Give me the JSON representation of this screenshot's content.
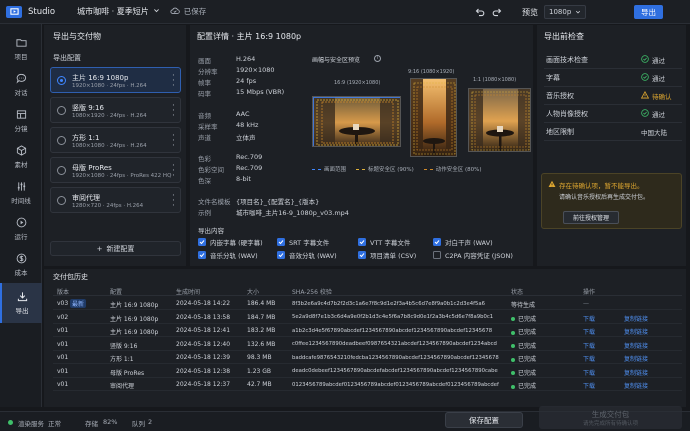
{
  "app": {
    "name": "Studio",
    "project": "城市咖啡 · 夏季短片",
    "saved": "已保存"
  },
  "toolbar": {
    "preview_label": "预览",
    "resolution": "1080p",
    "export_label": "导出"
  },
  "sidebar": [
    {
      "label": "项目",
      "icon": "folder-icon"
    },
    {
      "label": "对话",
      "icon": "chat-icon"
    },
    {
      "label": "分镜",
      "icon": "storyboard-icon"
    },
    {
      "label": "素材",
      "icon": "cube-icon"
    },
    {
      "label": "时间线",
      "icon": "sliders-icon"
    },
    {
      "label": "运行",
      "icon": "play-icon"
    },
    {
      "label": "成本",
      "icon": "dollar-icon"
    },
    {
      "label": "导出",
      "icon": "download-icon",
      "active": true
    }
  ],
  "left": {
    "title": "导出与交付物",
    "presets_label": "导出配置",
    "presets": [
      {
        "name": "主片 16:9 1080p",
        "desc": "1920×1080 · 24fps · H.264",
        "active": true
      },
      {
        "name": "竖版 9:16",
        "desc": "1080×1920 · 24fps · H.264"
      },
      {
        "name": "方形 1:1",
        "desc": "1080×1080 · 24fps · H.264"
      },
      {
        "name": "母版 ProRes",
        "desc": "1920×1080 · 24fps · ProRes 422 HQ"
      },
      {
        "name": "审阅代理",
        "desc": "1280×720 · 24fps · H.264"
      }
    ],
    "new_preset": "新建配置"
  },
  "details": {
    "title": "配置详情 · 主片 16:9 1080p",
    "video": [
      {
        "k": "画面",
        "v": "H.264"
      },
      {
        "k": "分辨率",
        "v": "1920×1080"
      },
      {
        "k": "帧率",
        "v": "24 fps"
      },
      {
        "k": "码率",
        "v": "15 Mbps (VBR)"
      }
    ],
    "audio": [
      {
        "k": "音频",
        "v": "AAC"
      },
      {
        "k": "采样率",
        "v": "48 kHz"
      },
      {
        "k": "声道",
        "v": "立体声"
      }
    ],
    "color": [
      {
        "k": "色彩",
        "v": "Rec.709"
      },
      {
        "k": "色彩空间",
        "v": "Rec.709"
      },
      {
        "k": "色深",
        "v": "8-bit"
      }
    ],
    "naming": [
      {
        "k": "文件名模板",
        "v": "{项目名}_{配置名}_{版本}"
      },
      {
        "k": "示例",
        "v": "城市咖啡_主片16-9_1080p_v03.mp4"
      }
    ],
    "safe_title": "画幅与安全区预览",
    "frames": [
      {
        "label": "16:9 (1920×1080)"
      },
      {
        "label": "9:16 (1080×1920)"
      },
      {
        "label": "1:1 (1080×1080)"
      }
    ],
    "legend": [
      {
        "label": "画面范围",
        "color": "#3f86ff"
      },
      {
        "label": "标题安全区 (90%)",
        "color": "#e0b23a"
      },
      {
        "label": "动作安全区 (80%)",
        "color": "#d08a2a"
      }
    ],
    "outputs_title": "导出内容",
    "outputs": [
      {
        "label": "内嵌字幕 (硬字幕)",
        "checked": true
      },
      {
        "label": "SRT 字幕文件",
        "checked": true
      },
      {
        "label": "VTT 字幕文件",
        "checked": true
      },
      {
        "label": "对白干声 (WAV)",
        "checked": true
      },
      {
        "label": "音乐分轨 (WAV)",
        "checked": true
      },
      {
        "label": "音效分轨 (WAV)",
        "checked": true
      },
      {
        "label": "项目清单 (CSV)",
        "checked": true
      },
      {
        "label": "C2PA 内容凭证 (JSON)",
        "checked": false
      }
    ]
  },
  "checks": {
    "title": "导出前检查",
    "items": [
      {
        "label": "画面技术检查",
        "status": "通过",
        "state": "pass"
      },
      {
        "label": "字幕",
        "status": "通过",
        "state": "pass"
      },
      {
        "label": "音乐授权",
        "status": "待确认",
        "state": "warn"
      },
      {
        "label": "人物肖像授权",
        "status": "通过",
        "state": "pass"
      },
      {
        "label": "地区限制",
        "status": "中国大陆",
        "state": "info"
      }
    ],
    "warn_title": "存在待确认项，暂不能导出。",
    "warn_body": "请确认音乐授权后再生成交付包。",
    "warn_button": "前往授权管理"
  },
  "history": {
    "title": "交付包历史",
    "columns": [
      "版本",
      "配置",
      "生成时间",
      "大小",
      "SHA-256 校验",
      "状态",
      "操作"
    ],
    "rows": [
      {
        "ver": "v03",
        "tag": "最新",
        "cfg": "主片 16:9 1080p",
        "time": "2024-05-18 14:22",
        "size": "186.4 MB",
        "sha": "8f3b2e6a9c4d7b2f2d3c1a6e7f8c9d1e2f3a4b5c6d7e8f9a0b1c2d3e4f5a6",
        "status": "等待生成",
        "state": "pending",
        "action1": "",
        "action2": ""
      },
      {
        "ver": "v02",
        "tag": "",
        "cfg": "主片 16:9 1080p",
        "time": "2024-05-18 13:58",
        "size": "184.7 MB",
        "sha": "5e2a9d8f7e1b3c6d4a9e0f2b1d3c4e5f6a7b8c9d0e1f2a3b4c5d6e7f8a9b0c1",
        "status": "已完成",
        "state": "done",
        "action1": "下载",
        "action2": "复制链接"
      },
      {
        "ver": "v01",
        "tag": "",
        "cfg": "主片 16:9 1080p",
        "time": "2024-05-18 12:41",
        "size": "183.2 MB",
        "sha": "a1b2c3d4e5f67890abcdef1234567890abcdef1234567890abcdef12345678",
        "status": "已完成",
        "state": "done",
        "action1": "下载",
        "action2": "复制链接"
      },
      {
        "ver": "v01",
        "tag": "",
        "cfg": "竖版 9:16",
        "time": "2024-05-18 12:40",
        "size": "132.6 MB",
        "sha": "c0ffee1234567890deadbeef0987654321abcdef1234567890abcdef1234abcd",
        "status": "已完成",
        "state": "done",
        "action1": "下载",
        "action2": "复制链接"
      },
      {
        "ver": "v01",
        "tag": "",
        "cfg": "方形 1:1",
        "time": "2024-05-18 12:39",
        "size": "98.3 MB",
        "sha": "baddcafe9876543210fedcba1234567890abcdef1234567890abcdef12345678",
        "status": "已完成",
        "state": "done",
        "action1": "下载",
        "action2": "复制链接"
      },
      {
        "ver": "v01",
        "tag": "",
        "cfg": "母版 ProRes",
        "time": "2024-05-18 12:38",
        "size": "1.23 GB",
        "sha": "deadc0debeef1234567890abcdefabcdef1234567890abcdef1234567890cabe",
        "status": "已完成",
        "state": "done",
        "action1": "下载",
        "action2": "复制链接"
      },
      {
        "ver": "v01",
        "tag": "",
        "cfg": "审阅代理",
        "time": "2024-05-18 12:37",
        "size": "42.7 MB",
        "sha": "0123456789abcdef0123456789abcdef0123456789abcdef0123456789abcdef",
        "status": "已完成",
        "state": "done",
        "action1": "下载",
        "action2": "复制链接"
      }
    ]
  },
  "footer": {
    "render_label": "渲染服务",
    "render_status": "正常",
    "storage_label": "存储",
    "storage_value": "82%",
    "queue_label": "队列",
    "queue_value": "2",
    "save_button": "保存配置",
    "generate_button": "生成交付包",
    "generate_hint": "请先完成所有待确认项"
  },
  "colors": {
    "accent": "#2f6fe0",
    "pass": "#3fbf6a",
    "warn": "#e0a830"
  }
}
